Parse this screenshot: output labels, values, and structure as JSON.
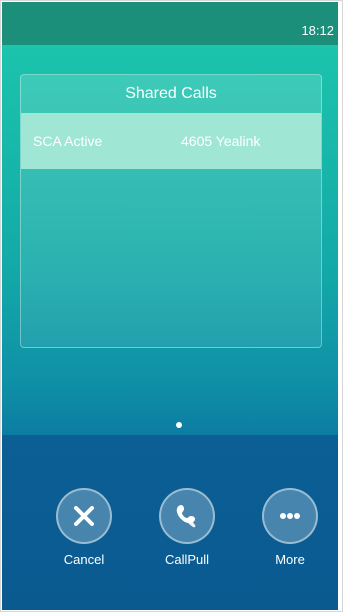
{
  "status_bar": {
    "time": "18:12"
  },
  "card": {
    "title": "Shared Calls",
    "active_row": {
      "left": "SCA Active",
      "right": "4605 Yealink"
    }
  },
  "pager": {
    "count": 1,
    "current": 1
  },
  "actions": [
    {
      "label": "Cancel",
      "icon": "close-icon"
    },
    {
      "label": "CallPull",
      "icon": "call-pull-icon"
    },
    {
      "label": "More",
      "icon": "more-icon"
    }
  ]
}
